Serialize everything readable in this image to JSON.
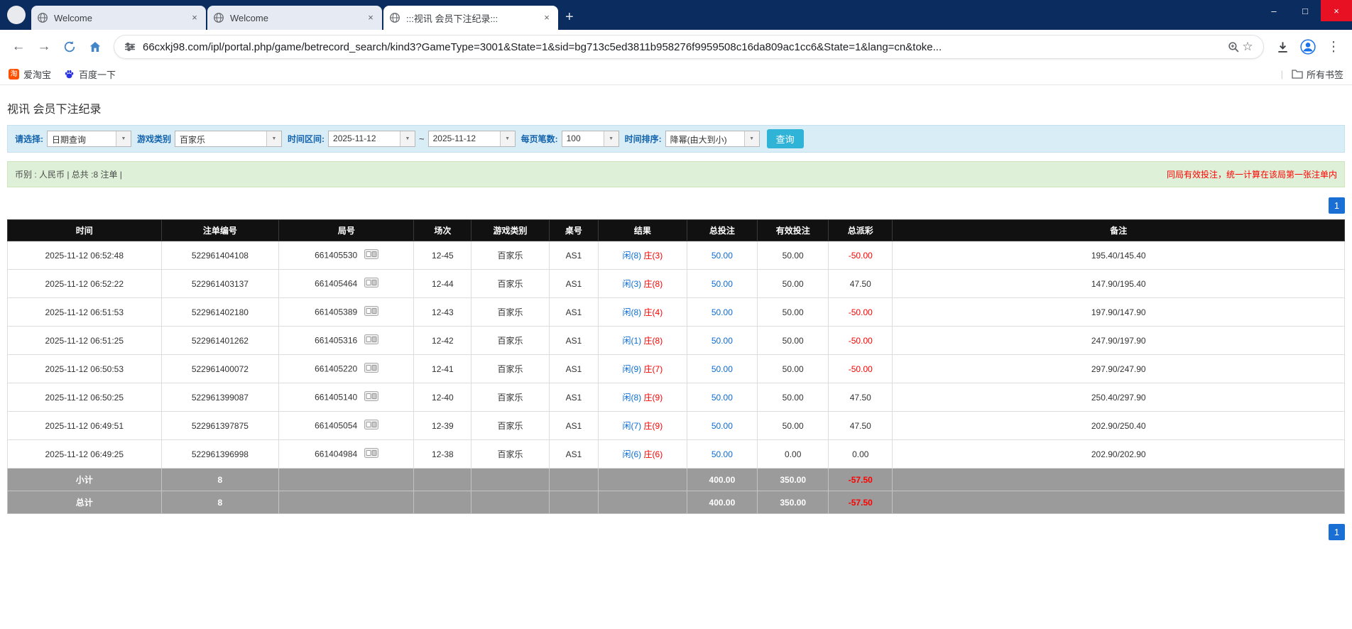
{
  "colors": {
    "tabstrip_navy": "#0a2c5e",
    "close_red": "#e81123",
    "accent_blue": "#1a6fd4",
    "link_blue": "#0a6cd6",
    "danger_red": "#ff0000",
    "player_blue": "#0a6cd6",
    "banker_red": "#ff0000",
    "button_teal": "#2fb3d6",
    "filter_bg": "#d9edf7",
    "summary_bg": "#dff0d8",
    "header_black": "#111111",
    "footer_gray": "#9b9b9b"
  },
  "browser": {
    "tabs": [
      {
        "title": "Welcome"
      },
      {
        "title": "Welcome"
      },
      {
        "title": ":::视讯 会员下注纪录:::"
      }
    ],
    "glyphs": {
      "tab_close": "×",
      "new_tab": "+",
      "minimize": "–",
      "maximize": "□",
      "close": "×",
      "back": "←",
      "forward": "→",
      "star": "☆",
      "menu": "⋮"
    },
    "url": "66cxkj98.com/ipl/portal.php/game/betrecord_search/kind3?GameType=3001&State=1&sid=bg713c5ed3811b958276f9959508c16da809ac1cc6&State=1&lang=cn&toke...",
    "bookmarks": [
      {
        "label": "爱淘宝",
        "icon_text": "淘"
      },
      {
        "label": "百度一下"
      }
    ],
    "bookmarks_right": "所有书签"
  },
  "page": {
    "title": "视讯 会员下注纪录",
    "filters": {
      "select_label": "请选择:",
      "select_value": "日期查询",
      "game_type_label": "游戏类别",
      "game_type_value": "百家乐",
      "date_range_label": "时间区间:",
      "date_from": "2025-11-12",
      "date_to": "2025-11-12",
      "tilde": "~",
      "page_size_label": "每页笔数:",
      "page_size_value": "100",
      "sort_label": "时间排序:",
      "sort_value": "降幂(由大到小)",
      "search_button": "查询",
      "dropdown_arrow": "▼"
    },
    "summary": {
      "left": "币别 : 人民币 | 总共 :8 注单 |",
      "right": "同局有效投注，统一计算在该局第一张注单内"
    },
    "pagination": {
      "page": "1"
    },
    "table": {
      "headers": [
        "时间",
        "注单编号",
        "局号",
        "场次",
        "游戏类别",
        "桌号",
        "结果",
        "总投注",
        "有效投注",
        "总派彩",
        "备注"
      ],
      "rows": [
        {
          "time": "2025-11-12 06:52:48",
          "bet_id": "522961404108",
          "round": "661405530",
          "session": "12-45",
          "game": "百家乐",
          "table": "AS1",
          "player": "闲(8)",
          "banker": "庄(3)",
          "total_bet": "50.00",
          "valid_bet": "50.00",
          "payout": "-50.00",
          "note": "195.40/145.40"
        },
        {
          "time": "2025-11-12 06:52:22",
          "bet_id": "522961403137",
          "round": "661405464",
          "session": "12-44",
          "game": "百家乐",
          "table": "AS1",
          "player": "闲(3)",
          "banker": "庄(8)",
          "total_bet": "50.00",
          "valid_bet": "50.00",
          "payout": "47.50",
          "note": "147.90/195.40"
        },
        {
          "time": "2025-11-12 06:51:53",
          "bet_id": "522961402180",
          "round": "661405389",
          "session": "12-43",
          "game": "百家乐",
          "table": "AS1",
          "player": "闲(8)",
          "banker": "庄(4)",
          "total_bet": "50.00",
          "valid_bet": "50.00",
          "payout": "-50.00",
          "note": "197.90/147.90"
        },
        {
          "time": "2025-11-12 06:51:25",
          "bet_id": "522961401262",
          "round": "661405316",
          "session": "12-42",
          "game": "百家乐",
          "table": "AS1",
          "player": "闲(1)",
          "banker": "庄(8)",
          "total_bet": "50.00",
          "valid_bet": "50.00",
          "payout": "-50.00",
          "note": "247.90/197.90"
        },
        {
          "time": "2025-11-12 06:50:53",
          "bet_id": "522961400072",
          "round": "661405220",
          "session": "12-41",
          "game": "百家乐",
          "table": "AS1",
          "player": "闲(9)",
          "banker": "庄(7)",
          "total_bet": "50.00",
          "valid_bet": "50.00",
          "payout": "-50.00",
          "note": "297.90/247.90"
        },
        {
          "time": "2025-11-12 06:50:25",
          "bet_id": "522961399087",
          "round": "661405140",
          "session": "12-40",
          "game": "百家乐",
          "table": "AS1",
          "player": "闲(8)",
          "banker": "庄(9)",
          "total_bet": "50.00",
          "valid_bet": "50.00",
          "payout": "47.50",
          "note": "250.40/297.90"
        },
        {
          "time": "2025-11-12 06:49:51",
          "bet_id": "522961397875",
          "round": "661405054",
          "session": "12-39",
          "game": "百家乐",
          "table": "AS1",
          "player": "闲(7)",
          "banker": "庄(9)",
          "total_bet": "50.00",
          "valid_bet": "50.00",
          "payout": "47.50",
          "note": "202.90/250.40"
        },
        {
          "time": "2025-11-12 06:49:25",
          "bet_id": "522961396998",
          "round": "661404984",
          "session": "12-38",
          "game": "百家乐",
          "table": "AS1",
          "player": "闲(6)",
          "banker": "庄(6)",
          "total_bet": "50.00",
          "valid_bet": "0.00",
          "payout": "0.00",
          "note": "202.90/202.90"
        }
      ],
      "subtotal": {
        "label": "小计",
        "count": "8",
        "total_bet": "400.00",
        "valid_bet": "350.00",
        "payout": "-57.50"
      },
      "total": {
        "label": "总计",
        "count": "8",
        "total_bet": "400.00",
        "valid_bet": "350.00",
        "payout": "-57.50"
      }
    }
  }
}
